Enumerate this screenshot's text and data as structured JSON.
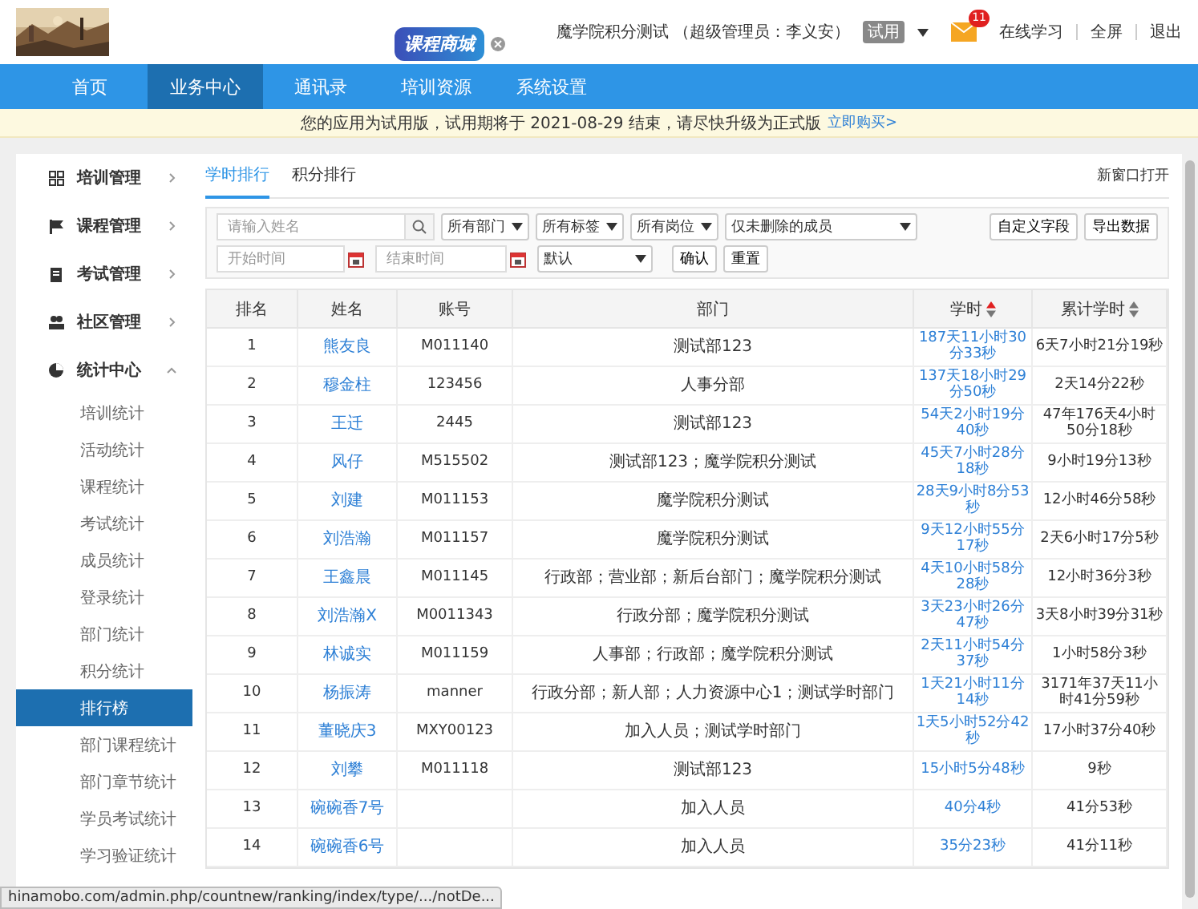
{
  "header": {
    "mall_badge": "课程商城",
    "user": "魔学院积分测试 （超级管理员：李义安）",
    "trial_tag": "试用",
    "mail_count": "11",
    "links": [
      "在线学习",
      "全屏",
      "退出"
    ]
  },
  "nav": [
    {
      "label": "首页",
      "selected": false
    },
    {
      "label": "业务中心",
      "selected": true
    },
    {
      "label": "通讯录",
      "selected": false
    },
    {
      "label": "培训资源",
      "selected": false
    },
    {
      "label": "系统设置",
      "selected": false
    }
  ],
  "notice": {
    "text": "您的应用为试用版，试用期将于 2021-08-29 结束，请尽快升级为正式版",
    "link": "立即购买>"
  },
  "sidebar": {
    "items": [
      {
        "label": "培训管理",
        "expanded": false
      },
      {
        "label": "课程管理",
        "expanded": false
      },
      {
        "label": "考试管理",
        "expanded": false
      },
      {
        "label": "社区管理",
        "expanded": false
      },
      {
        "label": "统计中心",
        "expanded": true,
        "children": [
          {
            "label": "培训统计",
            "selected": false
          },
          {
            "label": "活动统计",
            "selected": false
          },
          {
            "label": "课程统计",
            "selected": false
          },
          {
            "label": "考试统计",
            "selected": false
          },
          {
            "label": "成员统计",
            "selected": false
          },
          {
            "label": "登录统计",
            "selected": false
          },
          {
            "label": "部门统计",
            "selected": false
          },
          {
            "label": "积分统计",
            "selected": false
          },
          {
            "label": "排行榜",
            "selected": true
          },
          {
            "label": "部门课程统计",
            "selected": false
          },
          {
            "label": "部门章节统计",
            "selected": false
          },
          {
            "label": "学员考试统计",
            "selected": false
          },
          {
            "label": "学习验证统计",
            "selected": false
          }
        ]
      }
    ]
  },
  "tabs": [
    {
      "label": "学时排行",
      "selected": true
    },
    {
      "label": "积分排行",
      "selected": false
    }
  ],
  "open_new": "新窗口打开",
  "filters": {
    "search_placeholder": "请输入姓名",
    "selects": [
      "所有部门",
      "所有标签",
      "所有岗位",
      "仅未删除的成员"
    ],
    "buttons": [
      "自定义字段",
      "导出数据"
    ],
    "start_placeholder": "开始时间",
    "end_placeholder": "结束时间",
    "sort_select": "默认",
    "actions": [
      "确认",
      "重置"
    ]
  },
  "table": {
    "columns": [
      {
        "label": "排名",
        "sortable": false
      },
      {
        "label": "姓名",
        "sortable": false
      },
      {
        "label": "账号",
        "sortable": false
      },
      {
        "label": "部门",
        "sortable": false
      },
      {
        "label": "学时",
        "sortable": true,
        "sorted": true
      },
      {
        "label": "累计学时",
        "sortable": true,
        "sorted": false
      }
    ],
    "rows": [
      {
        "rank": "1",
        "name": "熊友良",
        "account": "M011140",
        "dept": "测试部123",
        "hours": "187天11小时30分33秒",
        "total": "6天7小时21分19秒"
      },
      {
        "rank": "2",
        "name": "穆金柱",
        "account": "123456",
        "dept": "人事分部",
        "hours": "137天18小时29分50秒",
        "total": "2天14分22秒"
      },
      {
        "rank": "3",
        "name": "王迁",
        "account": "2445",
        "dept": "测试部123",
        "hours": "54天2小时19分40秒",
        "total": "47年176天4小时50分18秒"
      },
      {
        "rank": "4",
        "name": "风仔",
        "account": "M515502",
        "dept": "测试部123；魔学院积分测试",
        "hours": "45天7小时28分18秒",
        "total": "9小时19分13秒"
      },
      {
        "rank": "5",
        "name": "刘建",
        "account": "M011153",
        "dept": "魔学院积分测试",
        "hours": "28天9小时8分53秒",
        "total": "12小时46分58秒"
      },
      {
        "rank": "6",
        "name": "刘浩瀚",
        "account": "M011157",
        "dept": "魔学院积分测试",
        "hours": "9天12小时55分17秒",
        "total": "2天6小时17分5秒"
      },
      {
        "rank": "7",
        "name": "王鑫晨",
        "account": "M011145",
        "dept": "行政部；营业部；新后台部门；魔学院积分测试",
        "hours": "4天10小时58分28秒",
        "total": "12小时36分3秒"
      },
      {
        "rank": "8",
        "name": "刘浩瀚X",
        "account": "M0011343",
        "dept": "行政分部；魔学院积分测试",
        "hours": "3天23小时26分47秒",
        "total": "3天8小时39分31秒"
      },
      {
        "rank": "9",
        "name": "林诚实",
        "account": "M011159",
        "dept": "人事部；行政部；魔学院积分测试",
        "hours": "2天11小时54分37秒",
        "total": "1小时58分3秒"
      },
      {
        "rank": "10",
        "name": "杨振涛",
        "account": "manner",
        "dept": "行政分部；新人部；人力资源中心1；测试学时部门",
        "hours": "1天21小时11分14秒",
        "total": "3171年37天11小时41分59秒"
      },
      {
        "rank": "11",
        "name": "董晓庆3",
        "account": "MXY00123",
        "dept": "加入人员；测试学时部门",
        "hours": "1天5小时52分42秒",
        "total": "17小时37分40秒"
      },
      {
        "rank": "12",
        "name": "刘攀",
        "account": "M011118",
        "dept": "测试部123",
        "hours": "15小时5分48秒",
        "total": "9秒"
      },
      {
        "rank": "13",
        "name": "碗碗香7号",
        "dept": "加入人员",
        "hours": "40分4秒",
        "total": "41分53秒"
      },
      {
        "rank": "14",
        "name": "碗碗香6号",
        "dept": "加入人员",
        "hours": "35分23秒",
        "total": "41分11秒"
      }
    ]
  },
  "status_bar": {
    "url": "hinamobo.com/admin.php/countnew/ranking/index/type/.../notDe..."
  }
}
